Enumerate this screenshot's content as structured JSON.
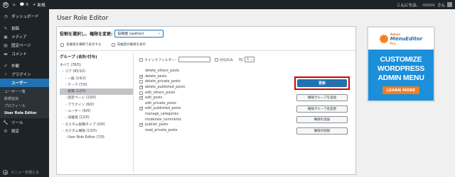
{
  "adminbar": {
    "comments_count": "0",
    "new_label": "新規",
    "greeting_prefix": "こんにちは、",
    "greeting_suffix": "さん"
  },
  "sidebar": {
    "items": [
      {
        "label": "ダッシュボード",
        "icon": "dashboard-icon"
      },
      {
        "label": "投稿",
        "icon": "pin-icon"
      },
      {
        "label": "メディア",
        "icon": "media-icon"
      },
      {
        "label": "固定ページ",
        "icon": "page-icon"
      },
      {
        "label": "コメント",
        "icon": "comment-icon"
      },
      {
        "label": "外観",
        "icon": "brush-icon"
      },
      {
        "label": "プラグイン",
        "icon": "plugin-icon"
      },
      {
        "label": "ユーザー",
        "icon": "users-icon"
      },
      {
        "label": "ツール",
        "icon": "wrench-icon"
      },
      {
        "label": "設定",
        "icon": "settings-icon"
      }
    ],
    "submenu": [
      "ユーザー一覧",
      "新規追加",
      "プロフィール",
      "User Role Editor"
    ],
    "collapse_label": "メニューを閉じる"
  },
  "page": {
    "title": "User Role Editor",
    "select_label": "役割を選択し、権限を変更:",
    "role_value": "投稿者 (author)",
    "opt_show_human": "名権限を横断で表示する",
    "opt_show_deprecated": "非推奨の権限を表示",
    "groups_title": "グループ (合計/付与)",
    "groups": [
      "すべて (78/5)",
      "- コア (65/10)",
      "- 一般 (14/2)",
      "- テーマ (7/0)",
      "- 投稿 (12/5)",
      "- 固定ページ (10/0)",
      "- プラグイン (6/0)",
      "- ユーザー (6/0)",
      "- 非推奨 (12/0)",
      "- カスタム投稿タイプ (0/0)",
      "- カスタム権限 (13/0)",
      "- User Role Editor (7/0)"
    ],
    "filter_label": "クイックフィルター:",
    "granted_only_label": "付与のみ",
    "columns_label": "列:",
    "columns_value": "1",
    "capabilities": [
      {
        "name": "delete_others_posts",
        "checked": false,
        "box": false
      },
      {
        "name": "delete_posts",
        "checked": true,
        "box": true
      },
      {
        "name": "delete_private_posts",
        "checked": false,
        "box": true
      },
      {
        "name": "delete_published_posts",
        "checked": true,
        "box": true
      },
      {
        "name": "edit_others_posts",
        "checked": false,
        "box": true
      },
      {
        "name": "edit_posts",
        "checked": true,
        "box": true
      },
      {
        "name": "edit_private_posts",
        "checked": false,
        "box": false
      },
      {
        "name": "edit_published_posts",
        "checked": true,
        "box": true
      },
      {
        "name": "manage_categories",
        "checked": false,
        "box": false
      },
      {
        "name": "moderate_comments",
        "checked": false,
        "box": false
      },
      {
        "name": "publish_posts",
        "checked": true,
        "box": true
      },
      {
        "name": "read_private_posts",
        "checked": false,
        "box": false
      }
    ],
    "update_label": "更新",
    "action_buttons": [
      "権限グループを追加",
      "権限グループ名変更",
      "権限の追加",
      "権限の削除"
    ]
  },
  "ad": {
    "brand": "MenuEditor",
    "brand_top": "Admin",
    "brand_pro": "Pro",
    "line1": "CUSTOMIZE",
    "line2": "WORDPRESS",
    "line3": "ADMIN MENU",
    "cta": "LEARN MORE"
  }
}
